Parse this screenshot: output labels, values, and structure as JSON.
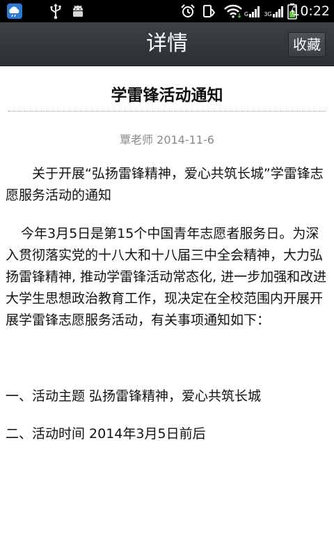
{
  "status_bar": {
    "time": "10:22",
    "icons": [
      "weather-cloud-icon",
      "usb-icon",
      "android-debug-icon",
      "alarm-icon",
      "vibrate-icon",
      "wifi-icon",
      "signal-icon",
      "signal-icon",
      "battery-charging-icon"
    ],
    "net_label_1": "G",
    "net_label_2": "3G"
  },
  "action_bar": {
    "title": "详情",
    "favorite_label": "收藏"
  },
  "article": {
    "title": "学雷锋活动通知",
    "meta": "覃老师 2014-11-6",
    "paragraphs": [
      "关于开展“弘扬雷锋精神，爱心共筑长城”学雷锋志愿服务活动的通知",
      "今年3月5日是第15个中国青年志愿者服务日。为深入贯彻落实党的十八大和十八届三中全会精神，大力弘扬雷锋精神, 推动学雷锋活动常态化, 进一步加强和改进大学生思想政治教育工作，现决定在全校范围内开展开展学雷锋志愿服务活动，有关事项通知如下：",
      "一、活动主题  弘扬雷锋精神，爱心共筑长城",
      "二、活动时间  2014年3月5日前后"
    ]
  },
  "colors": {
    "status_bar_bg": "#000000",
    "action_bar_bg": "#33393d",
    "text": "#111111",
    "meta_text": "#8a8a8a"
  }
}
